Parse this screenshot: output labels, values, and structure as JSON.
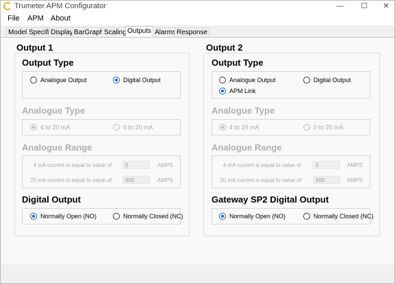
{
  "window": {
    "title": "Trumeter APM Configurator",
    "minimize": "—",
    "maximize": "☐",
    "close": "✕"
  },
  "menu": [
    "File",
    "APM",
    "About"
  ],
  "tabs": [
    "Model Specific",
    "Display",
    "BarGraph",
    "Scaling",
    "Outputs",
    "Alarms",
    "Response"
  ],
  "active_tab": "Outputs",
  "output1": {
    "title": "Output 1",
    "output_type": {
      "title": "Output Type",
      "options": [
        "Analogue Output",
        "Digital Output"
      ],
      "selected": "Digital Output"
    },
    "analogue_type": {
      "title": "Analogue Type",
      "options": [
        "4 to 20 mA",
        "0 to 20 mA"
      ],
      "selected": "4 to 20 mA",
      "enabled": false
    },
    "analogue_range": {
      "title": "Analogue Range",
      "rows": [
        {
          "label": "4 mA current is equal to value of",
          "value": "0",
          "unit": "AMPS"
        },
        {
          "label": "20 mA current is equal to value of",
          "value": "600",
          "unit": "AMPS"
        }
      ],
      "enabled": false
    },
    "digital_output": {
      "title": "Digital Output",
      "options": [
        "Normally Open (NO)",
        "Normally Closed (NC)"
      ],
      "selected": "Normally Open (NO)"
    }
  },
  "output2": {
    "title": "Output 2",
    "output_type": {
      "title": "Output Type",
      "options": [
        "Analogue Output",
        "Digital Output",
        "APM Link"
      ],
      "selected": "APM Link"
    },
    "analogue_type": {
      "title": "Analogue Type",
      "options": [
        "4 to 20 mA",
        "0 to 20 mA"
      ],
      "selected": "4 to 20 mA",
      "enabled": false
    },
    "analogue_range": {
      "title": "Analogue Range",
      "rows": [
        {
          "label": "4 mA current is equal to value of",
          "value": "0",
          "unit": "AMPS"
        },
        {
          "label": "20 mA current is equal to value of",
          "value": "600",
          "unit": "AMPS"
        }
      ],
      "enabled": false
    },
    "digital_output": {
      "title": "Gateway SP2 Digital Output",
      "options": [
        "Normally Open (NO)",
        "Normally Closed (NC)"
      ],
      "selected": "Normally Open (NO)"
    }
  },
  "colors": {
    "accent": "#0b5fd6",
    "disabled_text": "#a8a8a8",
    "app_icon": "#e8b21f"
  }
}
